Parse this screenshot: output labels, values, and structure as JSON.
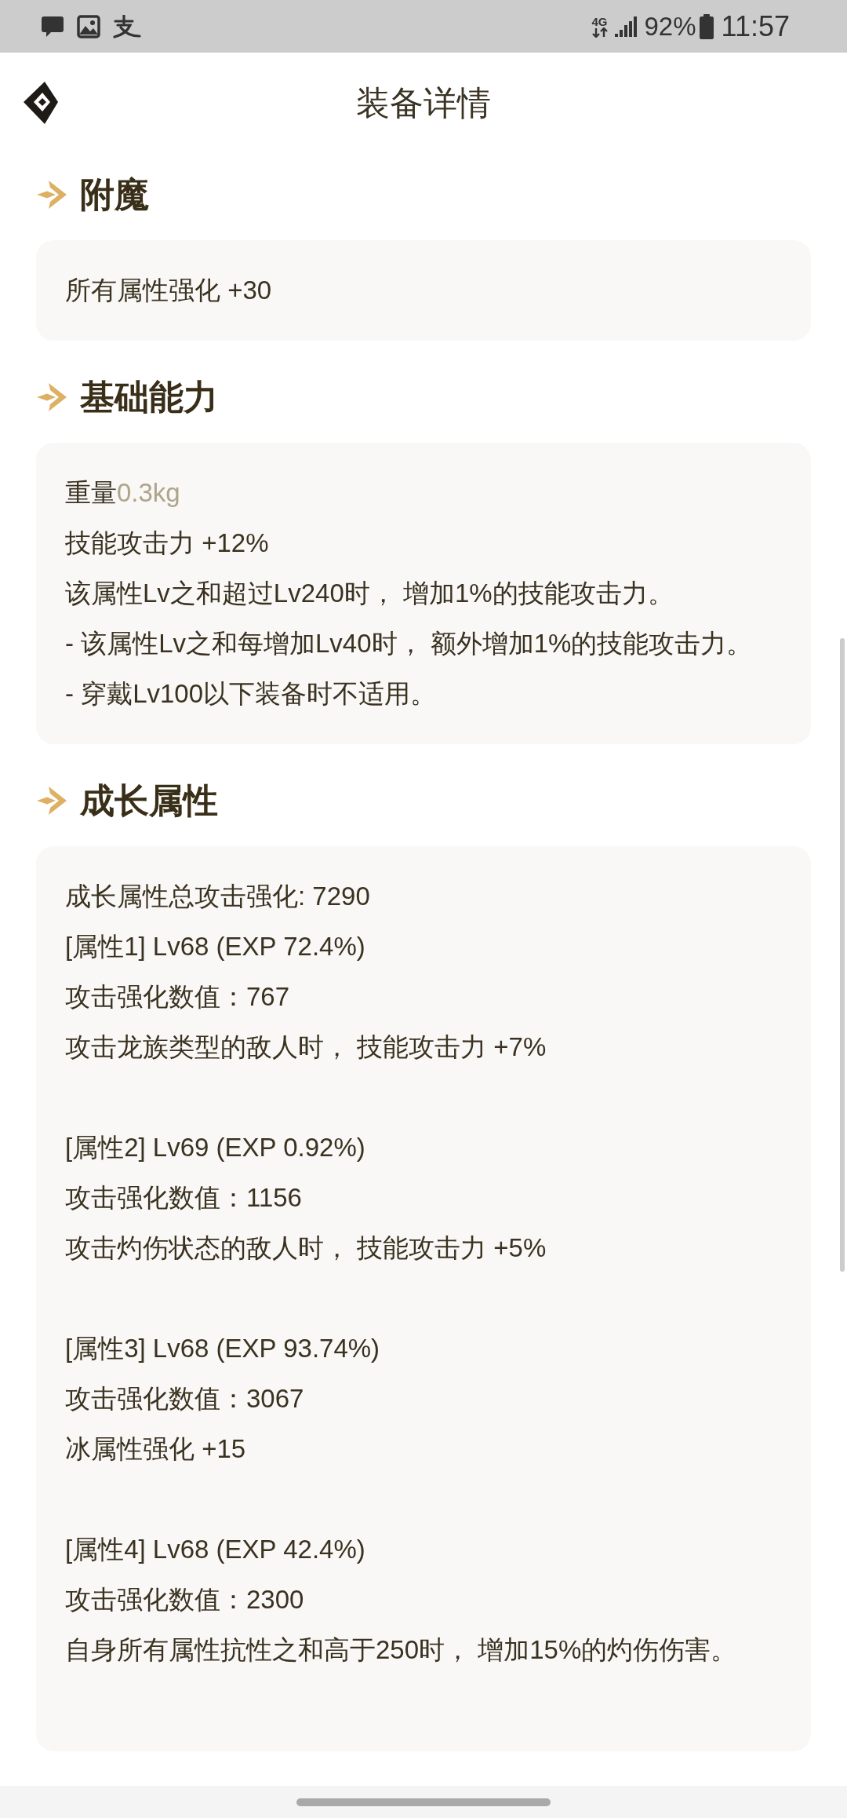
{
  "status_bar": {
    "network": "4G",
    "battery": "92%",
    "time": "11:57"
  },
  "header": {
    "title": "装备详情"
  },
  "sections": [
    {
      "title": "附魔",
      "blocks": [
        {
          "lines": [
            {
              "kind": "text",
              "text": "所有属性强化 +30"
            }
          ]
        }
      ]
    },
    {
      "title": "基础能力",
      "blocks": [
        {
          "lines": [
            {
              "kind": "pair",
              "label": "重量",
              "value": "0.3kg"
            },
            {
              "kind": "text",
              "text": "技能攻击力 +12%"
            },
            {
              "kind": "text",
              "text": "该属性Lv之和超过Lv240时， 增加1%的技能攻击力。"
            },
            {
              "kind": "text",
              "text": "- 该属性Lv之和每增加Lv40时， 额外增加1%的技能攻击力。"
            },
            {
              "kind": "text",
              "text": "- 穿戴Lv100以下装备时不适用。"
            }
          ]
        }
      ]
    },
    {
      "title": "成长属性",
      "blocks": [
        {
          "lines": [
            {
              "kind": "text",
              "text": "成长属性总攻击强化: 7290"
            },
            {
              "kind": "text",
              "text": "[属性1] Lv68 (EXP 72.4%)"
            },
            {
              "kind": "text",
              "text": "攻击强化数值：767"
            },
            {
              "kind": "text",
              "text": "攻击龙族类型的敌人时， 技能攻击力 +7%"
            }
          ]
        },
        {
          "lines": [
            {
              "kind": "text",
              "text": "[属性2] Lv69 (EXP 0.92%)"
            },
            {
              "kind": "text",
              "text": "攻击强化数值：1156"
            },
            {
              "kind": "text",
              "text": "攻击灼伤状态的敌人时， 技能攻击力 +5%"
            }
          ]
        },
        {
          "lines": [
            {
              "kind": "text",
              "text": "[属性3] Lv68 (EXP 93.74%)"
            },
            {
              "kind": "text",
              "text": "攻击强化数值：3067"
            },
            {
              "kind": "text",
              "text": "冰属性强化 +15"
            }
          ]
        },
        {
          "lines": [
            {
              "kind": "text",
              "text": "[属性4] Lv68 (EXP 42.4%)"
            },
            {
              "kind": "text",
              "text": "攻击强化数值：2300"
            },
            {
              "kind": "text",
              "text": "自身所有属性抗性之和高于250时， 增加15%的灼伤伤害。"
            }
          ]
        }
      ]
    }
  ]
}
